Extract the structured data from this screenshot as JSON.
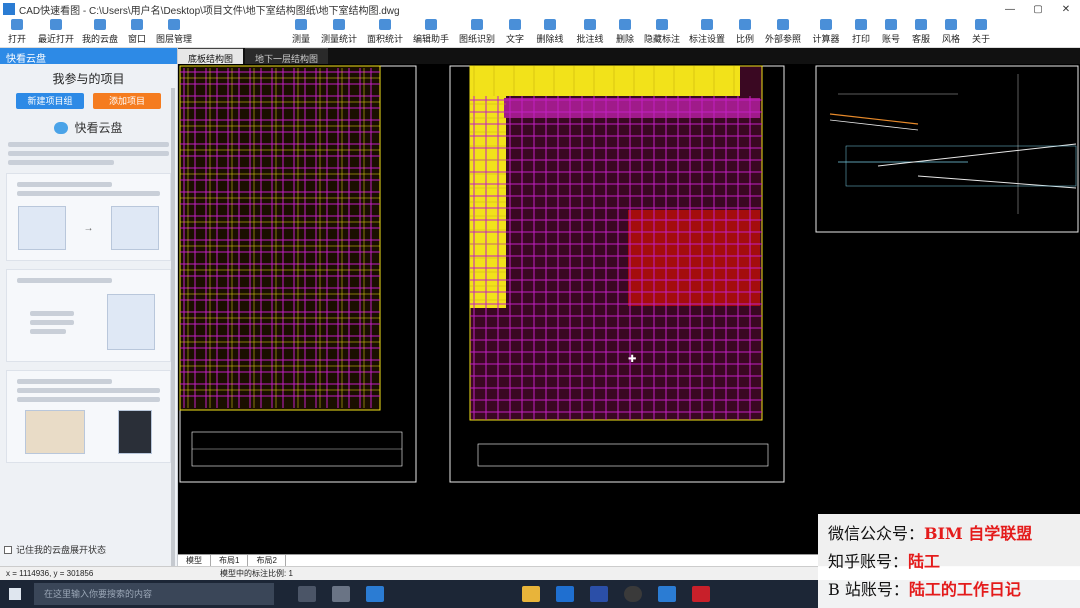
{
  "window": {
    "title": "CAD快速看图 - C:\\Users\\用户名\\Desktop\\项目文件\\地下室结构图纸\\地下室结构图.dwg",
    "controls": [
      "—",
      "▢",
      "✕"
    ]
  },
  "toolbar": {
    "items": [
      "打开",
      "最近打开",
      "我的云盘",
      "窗口",
      "图层管理",
      "",
      "测量",
      "测量统计",
      "面积统计",
      "编辑助手",
      "图纸识别",
      "文字",
      "删除线",
      "批注线",
      "删除",
      "隐藏标注",
      "标注设置",
      "比例",
      "外部参照",
      "计算器",
      "打印",
      "账号",
      "客服",
      "风格",
      "关于"
    ]
  },
  "left_panel": {
    "header": "快看云盘",
    "title": "我参与的项目",
    "buttons": [
      "新建项目组",
      "添加项目"
    ],
    "cloud_label": "快看云盘",
    "footer": "记住我的云盘展开状态"
  },
  "tabs": {
    "items": [
      "底板结构图",
      "地下一层结构图"
    ]
  },
  "layout_tabs": {
    "items": [
      "模型",
      "布局1",
      "布局2"
    ]
  },
  "status": {
    "coords": "x = 1114936, y = 301856",
    "hint": "模型中的标注比例: 1"
  },
  "taskbar": {
    "search_placeholder": "在这里输入你要搜索的内容"
  },
  "watermark": {
    "lines": [
      {
        "label": "微信公众号：",
        "value": "BIM 自学联盟"
      },
      {
        "label": "知乎账号：",
        "value": "陆工"
      },
      {
        "label": "B 站账号：",
        "value": "陆工的工作日记"
      }
    ]
  },
  "colors": {
    "accent": "#2d8ae6",
    "orange": "#f57c1f",
    "canvas_bg": "#000000",
    "drawing_magenta": "#c21fc2",
    "drawing_yellow": "#f2e21a",
    "drawing_red": "#a40d0d"
  }
}
